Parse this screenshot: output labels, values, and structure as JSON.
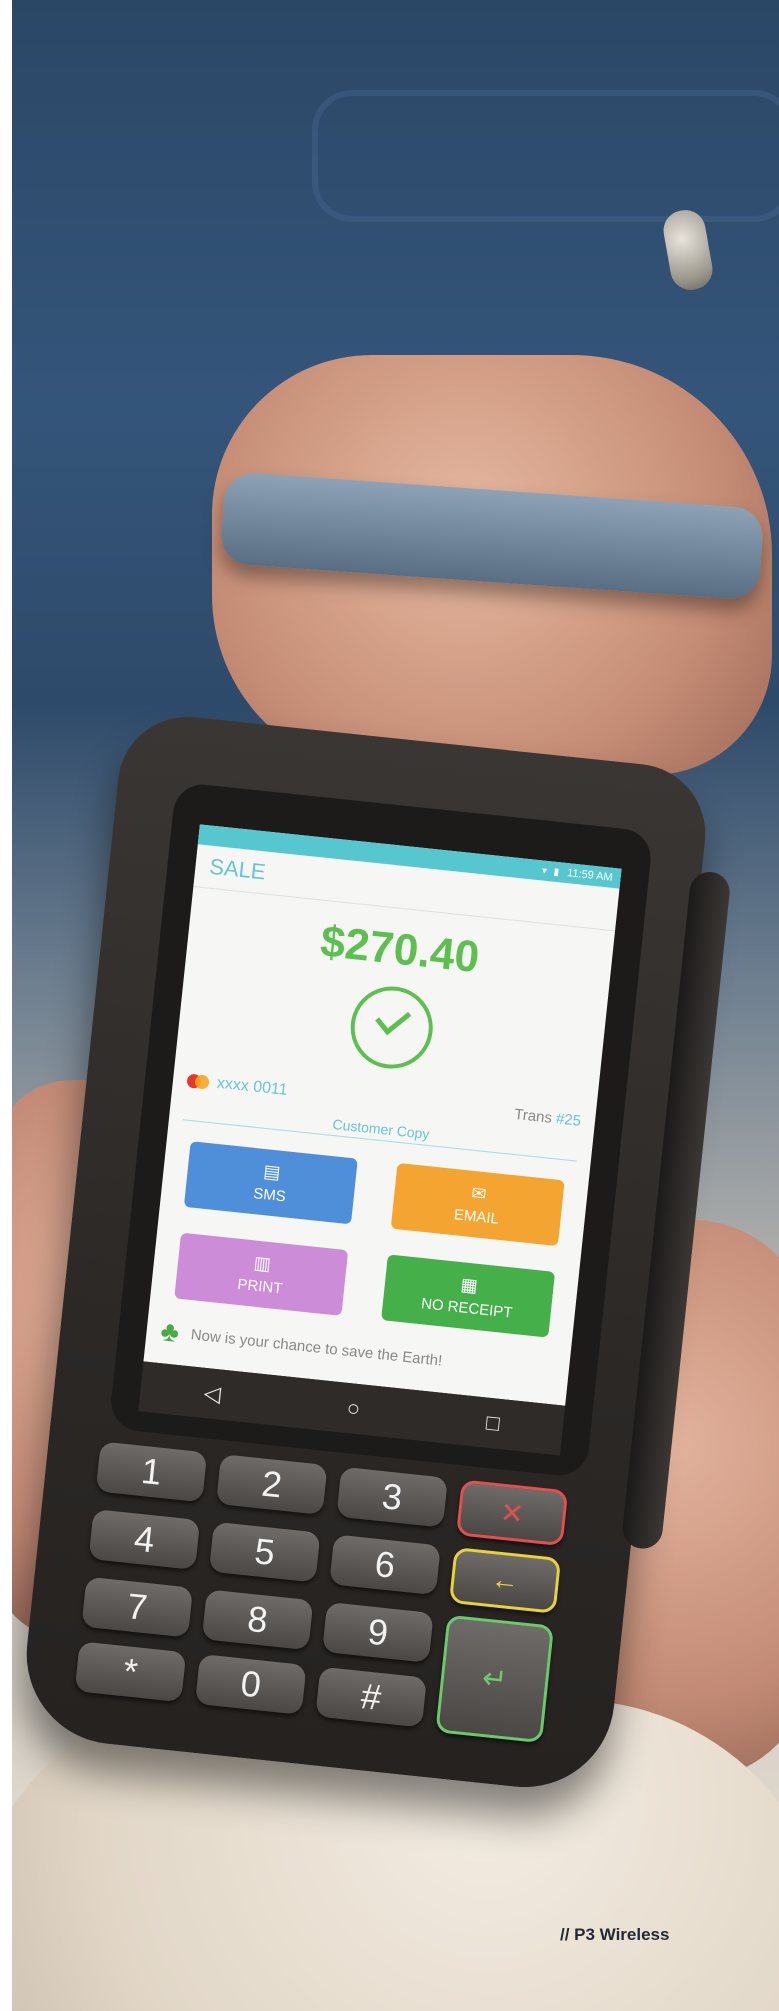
{
  "photo": {
    "subject": "payment terminal",
    "credit": "// P3 Wireless"
  },
  "terminal_screen": {
    "status_time": "11:59 AM",
    "title": "SALE",
    "amount": "$270.40",
    "card": "xxxx 0011",
    "trans_label": "Trans",
    "trans_number": "#25",
    "copy_label": "Customer Copy",
    "buttons": [
      {
        "label": "SMS",
        "icon": "chat-icon",
        "color": "#4f8ed8"
      },
      {
        "label": "EMAIL",
        "icon": "envelope-icon",
        "color": "#f4a431"
      },
      {
        "label": "PRINT",
        "icon": "printer-icon",
        "color": "#cd8cd8"
      },
      {
        "label": "NO RECEIPT",
        "icon": "receipt-icon",
        "color": "#45b04a"
      }
    ],
    "eco_message": "Now is your chance to save the Earth!"
  },
  "keypad": {
    "keys": [
      "1",
      "2",
      "3",
      "✕",
      "4",
      "5",
      "6",
      "←",
      "7",
      "8",
      "9",
      "↵",
      "*",
      "0",
      "#"
    ]
  },
  "colors": {
    "accent": "#6ac4d4",
    "success": "#5cbf4f"
  }
}
